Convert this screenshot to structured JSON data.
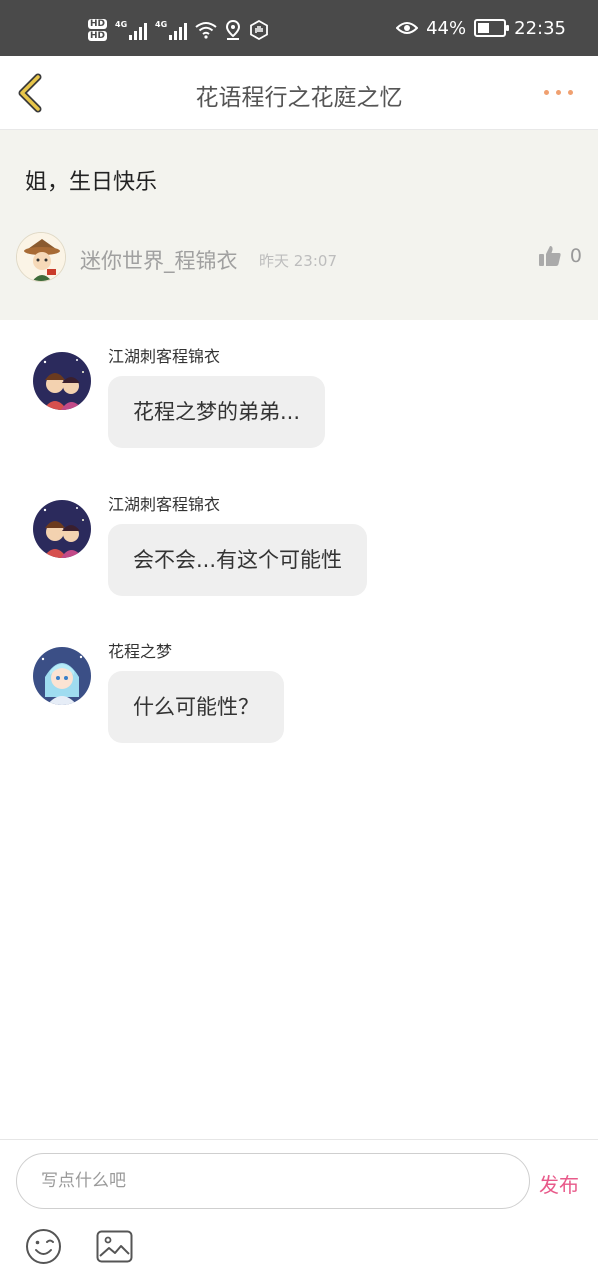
{
  "status_bar": {
    "hd1": "HD",
    "hd2": "HD",
    "network1": "4G",
    "network2": "4G",
    "battery_percent": "44%",
    "battery_level": 0.44,
    "time": "22:35"
  },
  "header": {
    "title": "花语程行之花庭之忆",
    "back_icon": "chevron-left-icon",
    "more_icon": "more-dots-icon"
  },
  "post": {
    "text": "姐，生日快乐",
    "username": "迷你世界_程锦衣",
    "time": "昨天 23:07",
    "like_count": "0"
  },
  "messages": [
    {
      "name": "江湖刺客程锦衣",
      "text": "花程之梦的弟弟..."
    },
    {
      "name": "江湖刺客程锦衣",
      "text": "会不会...有这个可能性"
    },
    {
      "name": "花程之梦",
      "text": "什么可能性？"
    }
  ],
  "input_bar": {
    "placeholder": "写点什么吧",
    "publish_label": "发布",
    "emoji_icon": "emoji-icon",
    "image_icon": "image-icon"
  },
  "colors": {
    "accent_pink": "#e85a8a",
    "more_dots": "#f0a070",
    "back_chevron": "#e8c64a",
    "post_bg": "#f3f3ee"
  }
}
